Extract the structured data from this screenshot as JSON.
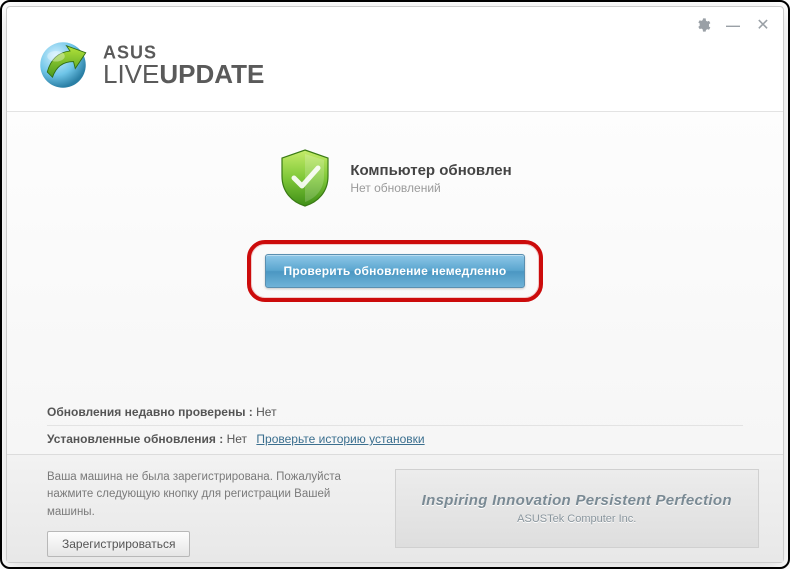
{
  "brand": {
    "asus": "ASUS",
    "live": "LIVE",
    "update": "UPDATE"
  },
  "status": {
    "title": "Компьютер обновлен",
    "subtitle": "Нет обновлений"
  },
  "action": {
    "check_now": "Проверить обновление немедленно"
  },
  "info": {
    "checked_label": "Обновления недавно проверены :",
    "checked_value": "Нет",
    "installed_label": "Установленные обновления :",
    "installed_value": "Нет",
    "history_link": "Проверьте историю установки"
  },
  "registration": {
    "message": "Ваша машина не была зарегистрирована. Пожалуйста нажмите следующую кнопку для регистрации Вашей машины.",
    "button": "Зарегистрироваться"
  },
  "footer_brand": {
    "slogan": "Inspiring Innovation  Persistent Perfection",
    "company": "ASUSTek Computer Inc."
  }
}
